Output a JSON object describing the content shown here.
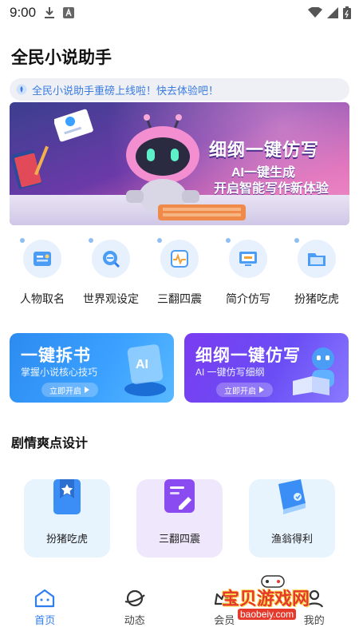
{
  "status": {
    "time": "9:00"
  },
  "app": {
    "title": "全民小说助手"
  },
  "notice": {
    "text": "全民小说助手重磅上线啦！快去体验吧！"
  },
  "banner": {
    "headline": "细纲一键仿写",
    "line1": "AI一键生成",
    "line2": "开启智能写作新体验"
  },
  "features": [
    {
      "label": "人物取名",
      "icon": "id-card-icon"
    },
    {
      "label": "世界观设定",
      "icon": "search-globe-icon"
    },
    {
      "label": "三翻四震",
      "icon": "pulse-icon"
    },
    {
      "label": "简介仿写",
      "icon": "monitor-icon"
    },
    {
      "label": "扮猪吃虎",
      "icon": "folder-icon"
    }
  ],
  "promos": [
    {
      "title": "一键拆书",
      "subtitle": "掌握小说核心技巧",
      "button": "立即开启"
    },
    {
      "title": "细纲一键仿写",
      "subtitle": "AI 一键仿写细纲",
      "button": "立即开启"
    }
  ],
  "section": {
    "title": "剧情爽点设计"
  },
  "plots": [
    {
      "label": "扮猪吃虎",
      "icon": "bookmark-star-icon"
    },
    {
      "label": "三翻四震",
      "icon": "notebook-pen-icon"
    },
    {
      "label": "渔翁得利",
      "icon": "book-icon"
    }
  ],
  "nav": [
    {
      "label": "首页",
      "active": true
    },
    {
      "label": "动态",
      "active": false
    },
    {
      "label": "会员",
      "active": false
    },
    {
      "label": "我的",
      "active": false
    }
  ],
  "watermark": {
    "title": "宝贝游戏网",
    "url": "baobeiy.com"
  },
  "colors": {
    "accent": "#2f7ef0",
    "notice_text": "#3a7be0",
    "promo_blue": "#2d8bf0",
    "promo_purple": "#7a3cf0"
  }
}
